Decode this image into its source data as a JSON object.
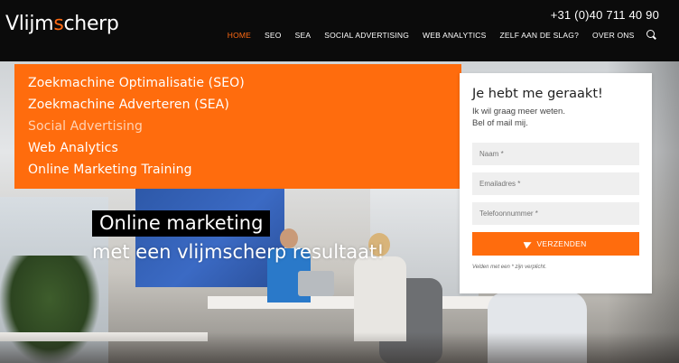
{
  "brand": {
    "logo_prefix": "Vlijm",
    "logo_accent": "s",
    "logo_suffix": "cherp",
    "phone": "+31 (0)40 711 40 90"
  },
  "nav": {
    "items": [
      {
        "label": "HOME",
        "active": true
      },
      {
        "label": "SEO",
        "active": false
      },
      {
        "label": "SEA",
        "active": false
      },
      {
        "label": "SOCIAL ADVERTISING",
        "active": false
      },
      {
        "label": "WEB ANALYTICS",
        "active": false
      },
      {
        "label": "ZELF AAN DE SLAG?",
        "active": false
      },
      {
        "label": "OVER ONS",
        "active": false
      }
    ],
    "search_icon": "search-icon"
  },
  "services": [
    {
      "label": "Zoekmachine Optimalisatie (SEO)"
    },
    {
      "label": "Zoekmachine Adverteren (SEA)"
    },
    {
      "label": "Social Advertising"
    },
    {
      "label": "Web Analytics"
    },
    {
      "label": "Online Marketing Training"
    }
  ],
  "hero": {
    "line1": "Online marketing",
    "line2": "met een vlijmscherp resultaat!"
  },
  "form": {
    "title": "Je hebt me geraakt!",
    "subtitle_line1": "Ik wil graag meer weten.",
    "subtitle_line2": "Bel of mail mij.",
    "name_placeholder": "Naam *",
    "email_placeholder": "Emailadres *",
    "phone_placeholder": "Telefoonnummer *",
    "submit_label": "VERZENDEN",
    "note": "Velden met een * zijn verplicht."
  },
  "colors": {
    "accent": "#ff6c0d",
    "header_bg": "#0b0b0b"
  }
}
